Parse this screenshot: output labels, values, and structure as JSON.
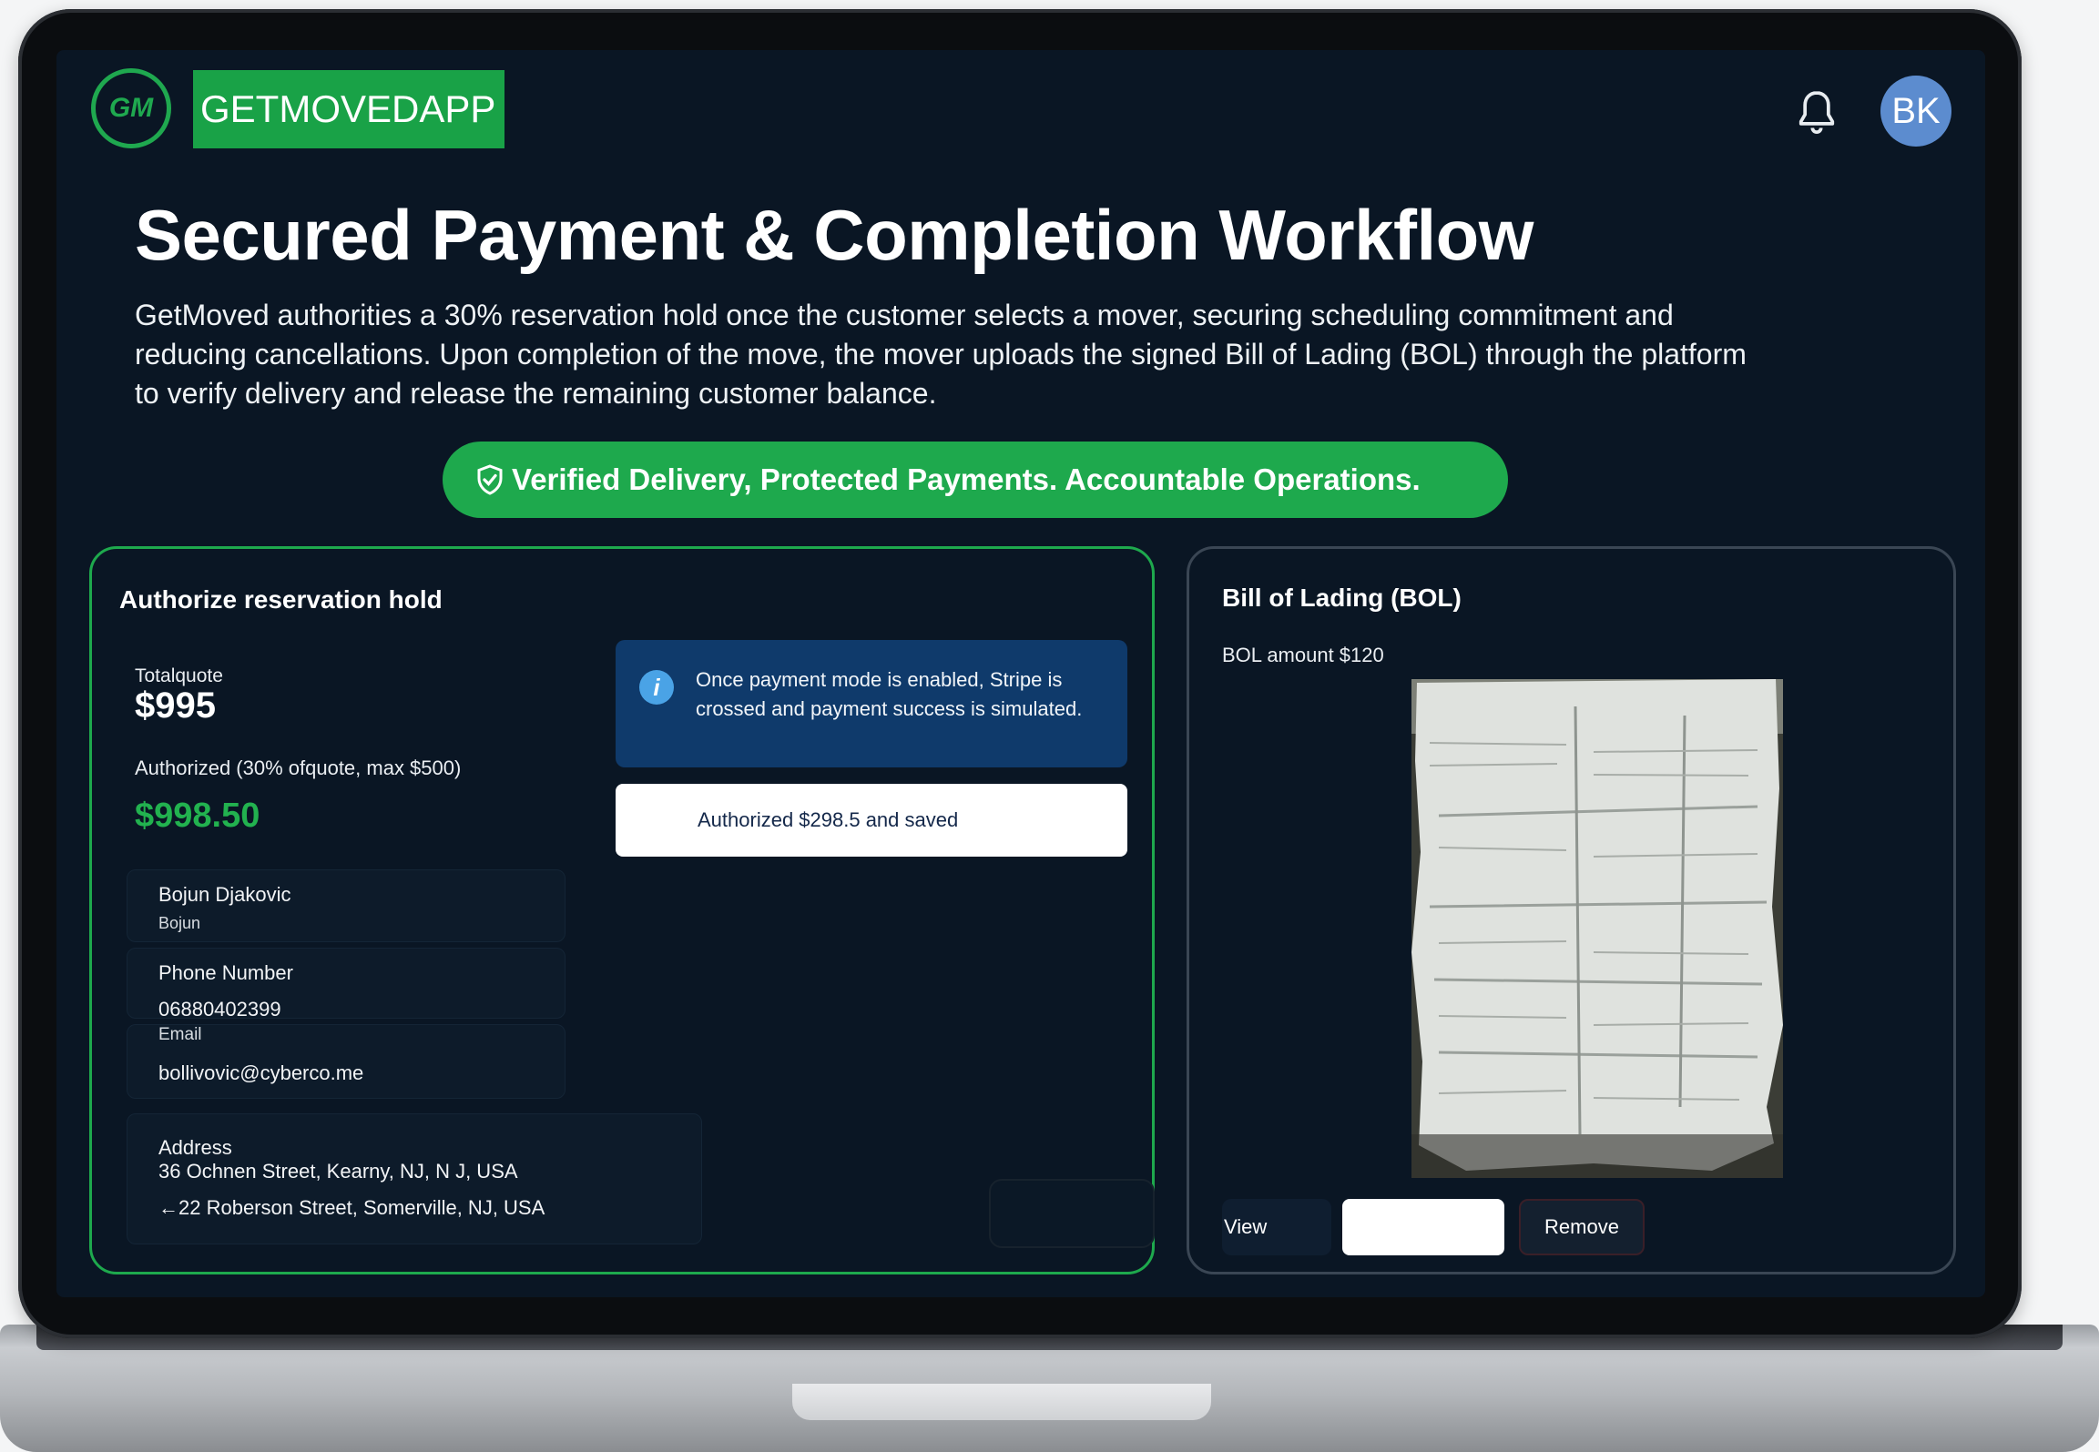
{
  "brand": {
    "logo_mark": "GM",
    "name": "GETMOVEDAPP"
  },
  "header": {
    "notifications_icon": "bell-icon",
    "avatar_initials": "BK"
  },
  "hero": {
    "title": "Secured Payment & Completion Workflow",
    "description": "GetMoved authorities a 30% reservation hold once the customer selects a mover, securing scheduling commitment and reducing cancellations. Upon completion of the move, the mover uploads the signed Bill of Lading (BOL) through the platform to verify delivery and release the remaining customer balance.",
    "banner": "Verified Delivery, Protected Payments. Accountable Operations."
  },
  "reservation": {
    "heading": "Authorize reservation hold",
    "total_label": "Totalquote",
    "total_value": "$995",
    "authorized_label": "Authorized (30% ofquote, max $500)",
    "authorized_value": "$998.50",
    "info_text": "Once payment mode is enabled, Stripe is crossed and payment success is simulated.",
    "status_text": "Authorized $298.5 and saved",
    "customer": {
      "name": "Bojun Djakovic",
      "name_sub": "Bojun",
      "phone_label": "Phone Number",
      "phone_value": "06880402399",
      "email_label": "Email",
      "email_value": "bollivovic@cyberco.me",
      "address_label": "Address",
      "address_from": "36 Ochnen Street, Kearny, NJ, N J, USA",
      "address_to": "←22 Roberson Street, Somerville, NJ, USA"
    }
  },
  "bol": {
    "heading": "Bill of Lading (BOL)",
    "amount_text": "BOL amount $120",
    "view_label": "View",
    "remove_label": "Remove"
  },
  "colors": {
    "accent": "#1ea94d",
    "screen_bg": "#0a1624",
    "info_bg": "#0f3a6b",
    "avatar": "#5c8ccf"
  }
}
